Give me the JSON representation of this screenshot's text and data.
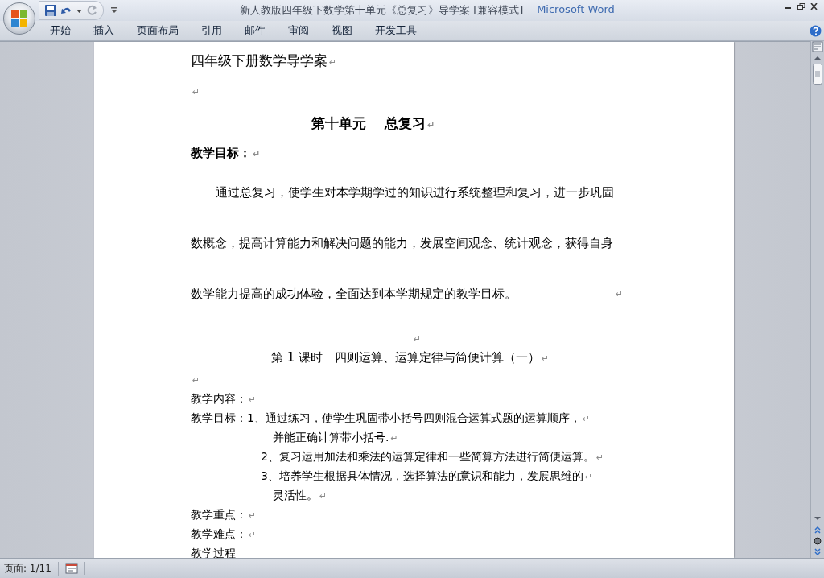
{
  "window": {
    "title": "新人教版四年级下数学第十单元《总复习》导学案 [兼容模式]",
    "title_separator": "-",
    "app_name": "Microsoft Word"
  },
  "ribbon": {
    "tabs": [
      "开始",
      "插入",
      "页面布局",
      "引用",
      "邮件",
      "审阅",
      "视图",
      "开发工具"
    ]
  },
  "document": {
    "paragraphs": [
      {
        "kind": "header",
        "lines": [
          "四年级下册数学导学案"
        ],
        "mark": "↵"
      },
      {
        "kind": "blank",
        "mark": "↵"
      },
      {
        "kind": "title",
        "lines": [
          "第十单元　 总复习"
        ],
        "mark": "↵"
      },
      {
        "kind": "section",
        "lines": [
          "教学目标："
        ],
        "mark": "↵"
      },
      {
        "kind": "body",
        "lines": [
          "通过总复习，使学生对本学期学过的知识进行系统整理和复习，进一步巩固",
          "数概念，提高计算能力和解决问题的能力，发展空间观念、统计观念，获得自身",
          "数学能力提高的成功体验，全面达到本学期规定的教学目标。"
        ],
        "mark": "↵"
      },
      {
        "kind": "center-blank",
        "mark": "↵"
      },
      {
        "kind": "lesson",
        "lines": [
          "第 1 课时　四则运算、运算定律与简便计算（一）"
        ],
        "mark": "↵"
      },
      {
        "kind": "blank-small",
        "mark": "↵"
      },
      {
        "kind": "plain",
        "lines": [
          "教学内容："
        ],
        "mark": "↵"
      },
      {
        "kind": "plain",
        "lines": [
          "教学目标：1、通过练习，使学生巩固带小括号四则混合运算式题的运算顺序，"
        ],
        "mark": "↵"
      },
      {
        "kind": "continuation",
        "lines": [
          "并能正确计算带小括号."
        ],
        "mark": "↵"
      },
      {
        "kind": "item",
        "lines": [
          "2、复习运用加法和乘法的运算定律和一些简算方法进行简便运算。"
        ],
        "mark": "↵"
      },
      {
        "kind": "item",
        "lines": [
          "3、培养学生根据具体情况，选择算法的意识和能力，发展思维的"
        ],
        "mark": "↵"
      },
      {
        "kind": "continuation",
        "lines": [
          "灵活性。"
        ],
        "mark": "↵"
      },
      {
        "kind": "plain",
        "lines": [
          "教学重点："
        ],
        "mark": "↵"
      },
      {
        "kind": "plain",
        "lines": [
          "教学难点："
        ],
        "mark": "↵"
      },
      {
        "kind": "plain",
        "lines": [
          "教学过程"
        ]
      }
    ]
  },
  "status_bar": {
    "page": "页面: 1/11"
  }
}
